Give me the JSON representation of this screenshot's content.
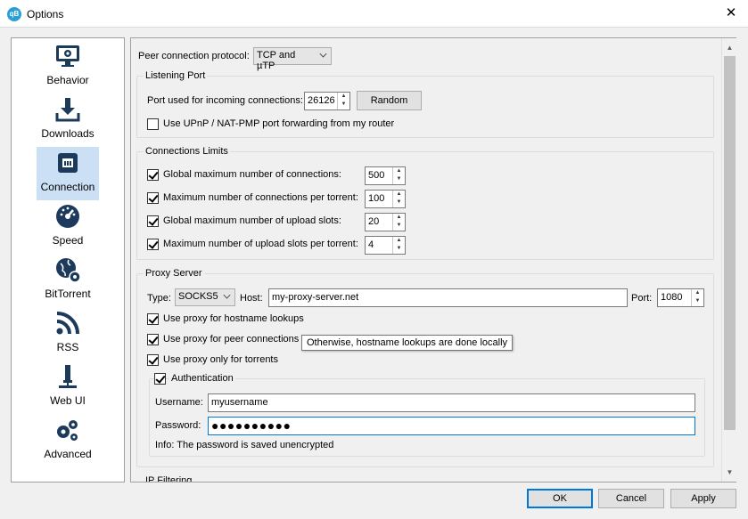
{
  "window": {
    "icon_text": "qB",
    "title": "Options",
    "close_glyph": "✕"
  },
  "sidebar": {
    "items": [
      {
        "label": "Behavior",
        "icon": "monitor-icon"
      },
      {
        "label": "Downloads",
        "icon": "download-icon"
      },
      {
        "label": "Connection",
        "icon": "network-icon",
        "selected": true
      },
      {
        "label": "Speed",
        "icon": "speedometer-icon"
      },
      {
        "label": "BitTorrent",
        "icon": "globe-gear-icon"
      },
      {
        "label": "RSS",
        "icon": "rss-icon"
      },
      {
        "label": "Web UI",
        "icon": "web-ui-icon"
      },
      {
        "label": "Advanced",
        "icon": "gears-icon"
      }
    ]
  },
  "connection": {
    "protocol_label": "Peer connection protocol:",
    "protocol_value": "TCP and µTP",
    "listening_port": {
      "title": "Listening Port",
      "port_label": "Port used for incoming connections:",
      "port_value": "26126",
      "random_button": "Random",
      "upnp_label": "Use UPnP / NAT-PMP port forwarding from my router",
      "upnp_checked": false
    },
    "limits": {
      "title": "Connections Limits",
      "rows": [
        {
          "label": "Global maximum number of connections:",
          "value": "500",
          "checked": true
        },
        {
          "label": "Maximum number of connections per torrent:",
          "value": "100",
          "checked": true
        },
        {
          "label": "Global maximum number of upload slots:",
          "value": "20",
          "checked": true
        },
        {
          "label": "Maximum number of upload slots per torrent:",
          "value": "4",
          "checked": true
        }
      ]
    },
    "proxy": {
      "title": "Proxy Server",
      "type_label": "Type:",
      "type_value": "SOCKS5",
      "host_label": "Host:",
      "host_value": "my-proxy-server.net",
      "port_label": "Port:",
      "port_value": "1080",
      "hostname_lookups_label": "Use proxy for hostname lookups",
      "peer_connections_label": "Use proxy for peer connections",
      "only_torrents_label": "Use proxy only for torrents",
      "tooltip": "Otherwise, hostname lookups are done locally",
      "auth": {
        "title": "Authentication",
        "username_label": "Username:",
        "username_value": "myusername",
        "password_label": "Password:",
        "password_value": "●●●●●●●●●●",
        "info": "Info: The password is saved unencrypted"
      }
    },
    "ip_filtering_title": "IP Filtering"
  },
  "footer": {
    "ok": "OK",
    "cancel": "Cancel",
    "apply": "Apply"
  },
  "colors": {
    "accent": "#0078d7",
    "selection": "#cce0f5",
    "icon_dark": "#1c3a5c"
  }
}
